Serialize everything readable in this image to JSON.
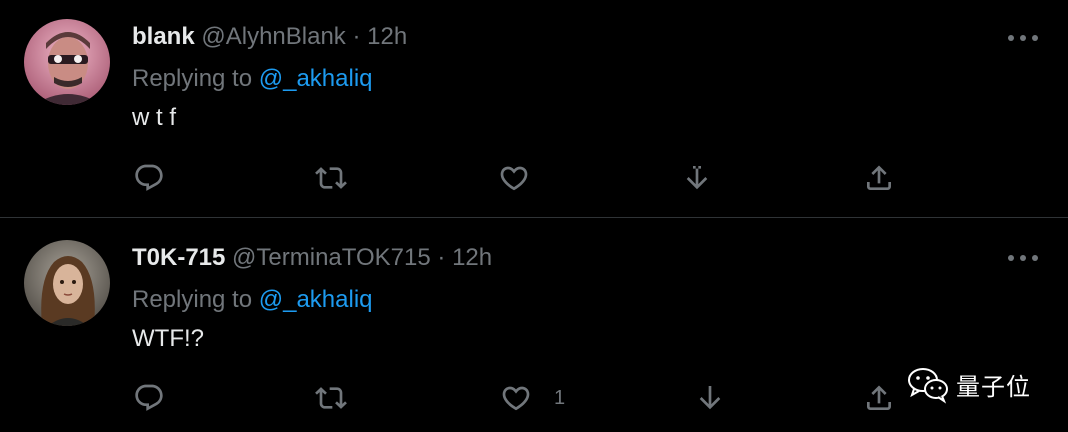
{
  "tweets": [
    {
      "display_name": "blank",
      "handle": "@AlyhnBlank",
      "separator": "·",
      "time": "12h",
      "replying_prefix": "Replying to",
      "replying_to": "@_akhaliq",
      "text": "w t f",
      "like_count": ""
    },
    {
      "display_name": "T0K-715",
      "handle": "@TerminaTOK715",
      "separator": "·",
      "time": "12h",
      "replying_prefix": "Replying to",
      "replying_to": "@_akhaliq",
      "text": "WTF!?",
      "like_count": "1"
    }
  ],
  "watermark": {
    "text": "量子位",
    "icon": "wechat-icon"
  },
  "colors": {
    "background": "#000000",
    "primary_text": "#e7e9ea",
    "secondary_text": "#71767b",
    "mention": "#1d9bf0",
    "divider": "#2f3336"
  },
  "icons": {
    "reply": "reply-icon",
    "retweet": "retweet-icon",
    "like": "heart-icon",
    "downvote": "downvote-icon",
    "share": "share-icon",
    "more": "more-icon"
  }
}
